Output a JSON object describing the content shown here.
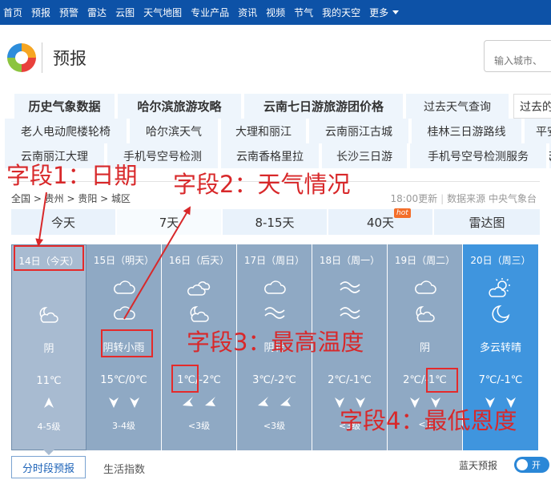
{
  "topnav": {
    "items": [
      "首页",
      "预报",
      "预警",
      "雷达",
      "云图",
      "天气地图",
      "专业产品",
      "资讯",
      "视频",
      "节气",
      "我的天空"
    ],
    "more": "更多"
  },
  "header": {
    "title": "预报",
    "search_placeholder": "输入城市、"
  },
  "links": {
    "row1": [
      "历史气象数据",
      "哈尔滨旅游攻略",
      "云南七日游旅游团价格",
      "过去天气查询",
      "过去的"
    ],
    "row2": [
      "老人电动爬楼轮椅",
      "哈尔滨天气",
      "大理和丽江",
      "云南丽江古城",
      "桂林三日游路线",
      "平安"
    ],
    "row3": [
      "云南丽江大理",
      "手机号空号检测",
      "云南香格里拉",
      "长沙三日游",
      "手机号空号检测服务",
      "云南"
    ]
  },
  "panel": {
    "breadcrumb": "全国 > 贵州 > 贵阳 > 城区",
    "update_time": "18:00更新",
    "source": "数据来源 中央气象台",
    "tabs": [
      "今天",
      "7天",
      "8-15天",
      "40天",
      "雷达图"
    ],
    "hot": "hot",
    "days": [
      {
        "date": "14日（今天）",
        "icon1": "",
        "icon2": "cloud-moon-icon",
        "cond": "阴",
        "temp": "11℃",
        "wind1": "up-arrow-icon",
        "wind2": "",
        "level": "4-5级"
      },
      {
        "date": "15日（明天）",
        "icon1": "cloud-icon",
        "icon2": "cloud-icon",
        "cond": "阴转小雨",
        "temp": "15℃/0℃",
        "wind1": "down-arrow-icon",
        "wind2": "down-arrow-icon",
        "level": "3-4级"
      },
      {
        "date": "16日（后天）",
        "icon1": "partly-cloudy-icon",
        "icon2": "cloud-moon-icon",
        "cond": "",
        "temp": "1℃/-2℃",
        "wind1": "left-arrow-icon",
        "wind2": "left-arrow-icon",
        "level": "<3级"
      },
      {
        "date": "17日（周日）",
        "icon1": "cloud-icon",
        "icon2": "fog-icon",
        "cond": "阴转",
        "temp": "3℃/-2℃",
        "wind1": "left-arrow-icon",
        "wind2": "left-arrow-icon",
        "level": "<3级"
      },
      {
        "date": "18日（周一）",
        "icon1": "fog-icon",
        "icon2": "fog-icon",
        "cond": "",
        "temp": "2℃/-1℃",
        "wind1": "down-arrow-icon",
        "wind2": "down-arrow-icon",
        "level": "<3级"
      },
      {
        "date": "19日（周二）",
        "icon1": "cloud-icon",
        "icon2": "cloud-moon-icon",
        "cond": "阴",
        "temp": "2℃/-1℃",
        "wind1": "down-arrow-icon",
        "wind2": "down-arrow-icon",
        "level": "<3"
      },
      {
        "date": "20日（周三）",
        "icon1": "sun-cloud-icon",
        "icon2": "moon-icon",
        "cond": "多云转晴",
        "temp": "7℃/-1℃",
        "wind1": "down-arrow-icon",
        "wind2": "down-arrow-icon",
        "level": ""
      }
    ],
    "subtabs": {
      "active": "分时段预报",
      "other": "生活指数"
    },
    "toggle_label": "蓝天预报",
    "toggle_text": "开"
  },
  "annotations": {
    "field1": "字段1：日期",
    "field2": "字段2：天气情况",
    "field3": "字段3：最高温度",
    "field4": "字段4：最低恩度",
    "color": "#d8282a"
  }
}
